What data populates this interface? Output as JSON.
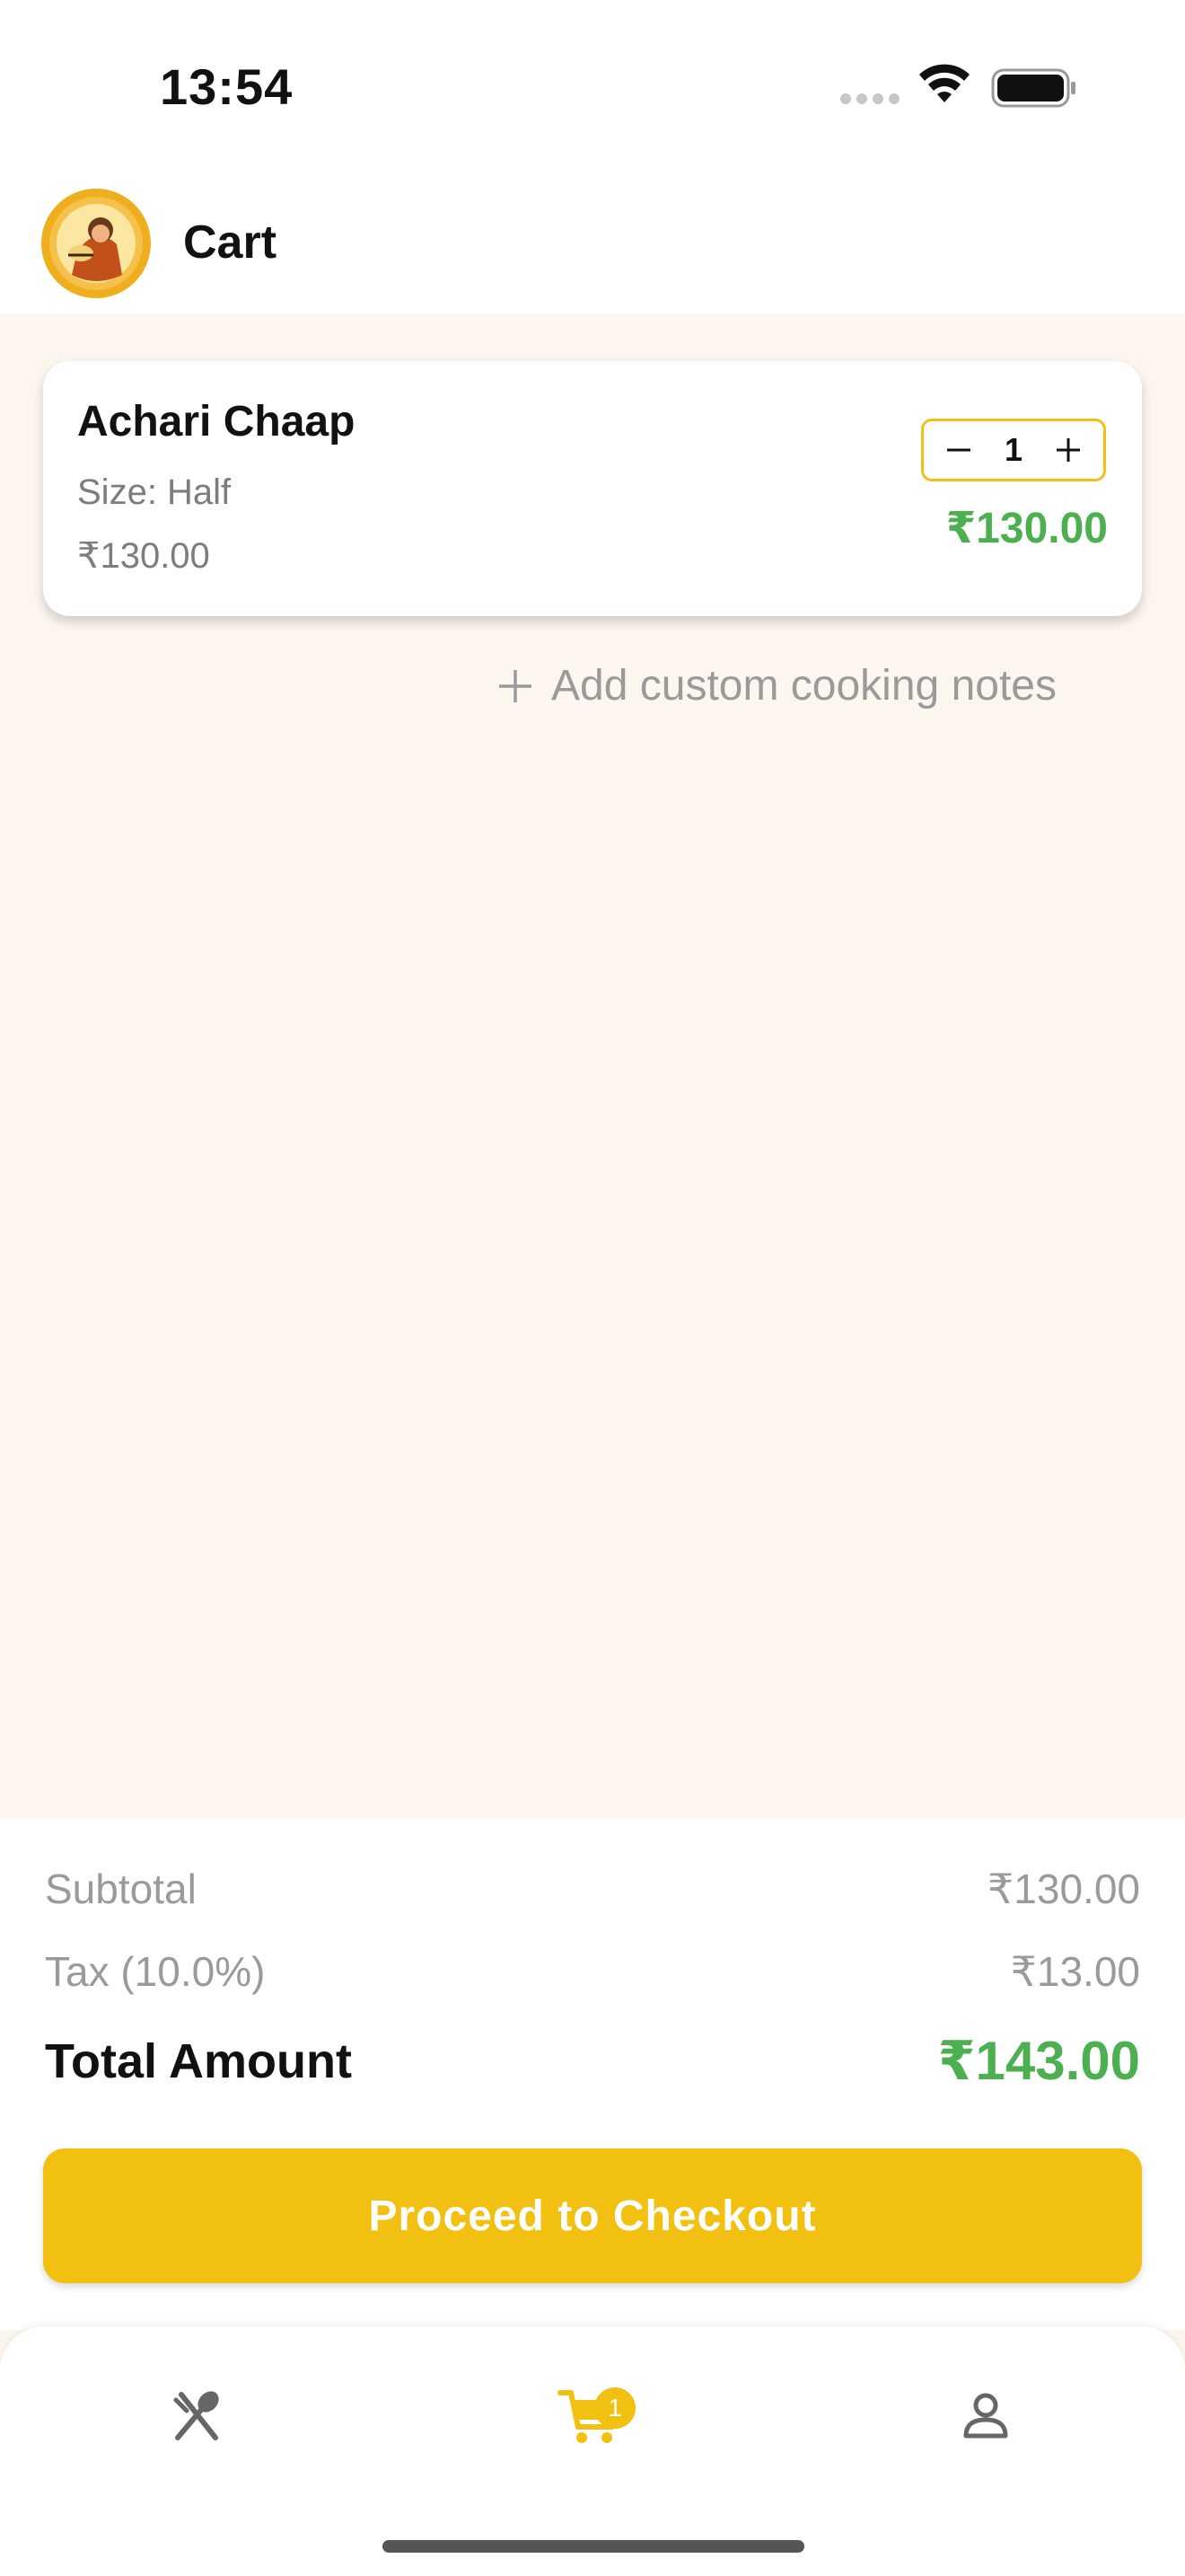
{
  "status_bar": {
    "time": "13:54"
  },
  "header": {
    "title": "Cart",
    "logo_icon": "restaurant-logo-icon"
  },
  "cart": {
    "items": [
      {
        "name": "Achari Chaap",
        "size": "Size: Half",
        "unit_price": "₹130.00",
        "quantity": "1",
        "line_total": "₹130.00"
      }
    ],
    "notes_label": "Add custom cooking notes"
  },
  "summary": {
    "subtotal_label": "Subtotal",
    "subtotal_value": "₹130.00",
    "tax_label": "Tax (10.0%)",
    "tax_value": "₹13.00",
    "total_label": "Total Amount",
    "total_value": "₹143.00",
    "checkout_label": "Proceed to Checkout"
  },
  "tabbar": {
    "tabs": [
      {
        "icon": "fork-spoon-icon",
        "active": false
      },
      {
        "icon": "cart-icon",
        "active": true,
        "badge": "1"
      },
      {
        "icon": "profile-icon",
        "active": false
      }
    ]
  },
  "colors": {
    "accent": "#f2c010",
    "price_green": "#4caf50",
    "background": "#fdf6ef"
  }
}
